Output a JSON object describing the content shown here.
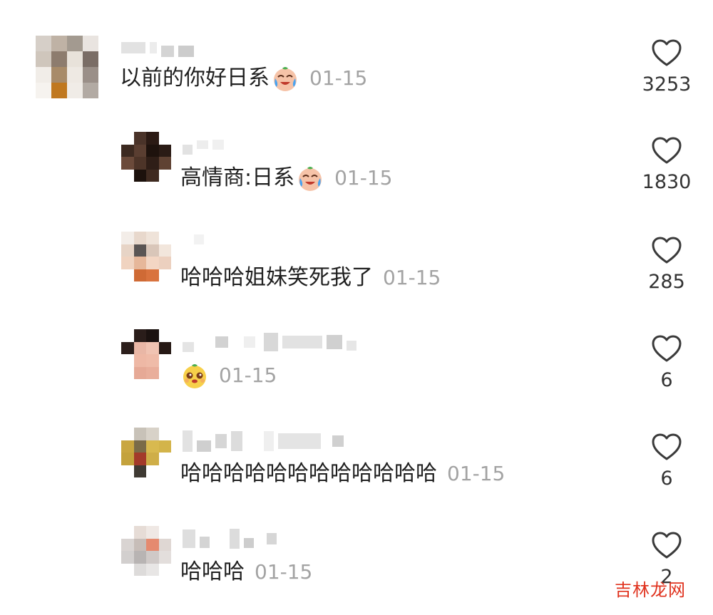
{
  "colors": {
    "date": "#a3a3a3",
    "text": "#1f1f1f",
    "count": "#333333",
    "heart": "#3a3a3a",
    "watermark": "#e0321e"
  },
  "comments": [
    {
      "text": "以前的你好日系",
      "emoji": "laugh-cry-emoji",
      "date": "01-15",
      "likes": "3253"
    },
    {
      "text": "高情商:日系",
      "emoji": "laugh-cry-emoji",
      "date": "01-15",
      "likes": "1830"
    },
    {
      "text": "哈哈哈姐妹笑死我了",
      "emoji": "",
      "date": "01-15",
      "likes": "285"
    },
    {
      "text": "",
      "emoji": "smirk-face-emoji",
      "date": "01-15",
      "likes": "6"
    },
    {
      "text": "哈哈哈哈哈哈哈哈哈哈哈哈",
      "emoji": "",
      "date": "01-15",
      "likes": "6"
    },
    {
      "text": "哈哈哈",
      "emoji": "",
      "date": "01-15",
      "likes": "2"
    }
  ],
  "watermark": "吉林龙网"
}
